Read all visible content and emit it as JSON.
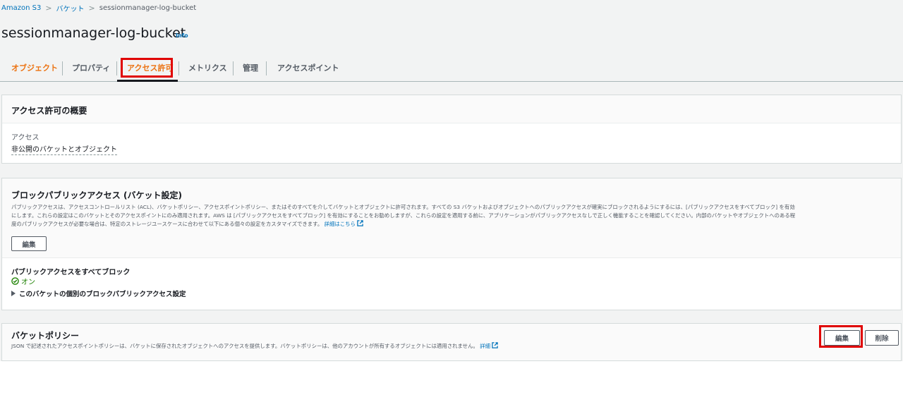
{
  "breadcrumb": {
    "items": [
      "Amazon S3",
      "バケット",
      "sessionmanager-log-bucket"
    ],
    "separator": ">"
  },
  "header": {
    "title": "sessionmanager-log-bucket",
    "info": "Info"
  },
  "tabs": [
    {
      "label": "オブジェクト",
      "state": "visited"
    },
    {
      "label": "プロパティ",
      "state": "normal"
    },
    {
      "label": "アクセス許可",
      "state": "selected"
    },
    {
      "label": "メトリクス",
      "state": "normal"
    },
    {
      "label": "管理",
      "state": "normal"
    },
    {
      "label": "アクセスポイント",
      "state": "normal"
    }
  ],
  "overview": {
    "title": "アクセス許可の概要",
    "access_label": "アクセス",
    "access_value": "非公開のバケットとオブジェクト"
  },
  "block_public": {
    "title": "ブロックパブリックアクセス (バケット設定)",
    "description_line1": "パブリックアクセスは、アクセスコントロールリスト (ACL)、バケットポリシー、アクセスポイントポリシー、またはそのすべてを介してバケットとオブジェクトに許可されます。すべての S3 バケットおよびオブジェクトへのパブリックアクセスが確実にブロックされるようにするには、[パブリックアクセスをすべてブロック] を有効",
    "description_line2": "にします。これらの設定はこのバケットとそのアクセスポイントにのみ適用されます。AWS は [パブリックアクセスをすべてブロック] を有効にすることをお勧めしますが、これらの設定を適用する前に、アプリケーションがパブリックアクセスなしで正しく機能することを確認してください。内部のバケットやオブジェクトへのある程",
    "description_line3": "度のパブリックアクセスが必要な場合は、特定のストレージユースケースに合わせて以下にある個々の設定をカスタマイズできます。",
    "learn_more": "詳細はこちら",
    "edit_button": "編集",
    "block_all_label": "パブリックアクセスをすべてブロック",
    "block_all_status": "オン",
    "expand_label": "このバケットの個別のブロックパブリックアクセス設定"
  },
  "bucket_policy": {
    "title": "バケットポリシー",
    "description": "JSON で記述されたアクセスポイントポリシーは、バケットに保存されたオブジェクトへのアクセスを提供します。バケットポリシーは、他のアカウントが所有するオブジェクトには適用されません。",
    "learn_more": "詳細",
    "edit_button": "編集",
    "delete_button": "削除"
  },
  "colors": {
    "link": "#0073bb",
    "active_tab": "#ec7211",
    "highlight": "#e00000",
    "success": "#1d8102"
  }
}
